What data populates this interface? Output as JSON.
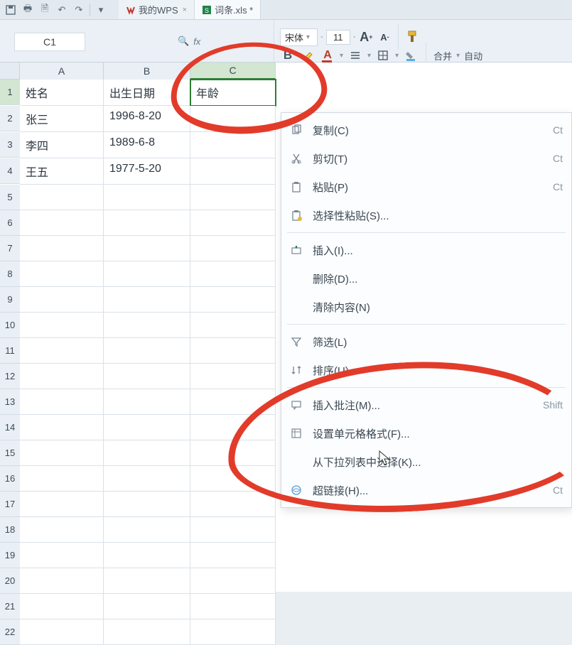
{
  "qat": {
    "save": "💾",
    "undo": "↶",
    "redo": "↷"
  },
  "tabs": [
    {
      "icon_color": "#c0392b",
      "label": "我的WPS",
      "closable": true,
      "active": false
    },
    {
      "icon_color": "#1e8449",
      "label": "词条.xls *",
      "closable": false,
      "active": true
    }
  ],
  "cell_ref": "C1",
  "fx_label": "fx",
  "font": {
    "name": "宋体",
    "size": "11",
    "inc_label": "A",
    "dec_label": "A",
    "bold": "B",
    "underline_a": "A",
    "merge_label": "合并",
    "auto_label": "自动"
  },
  "columns": [
    "A",
    "B",
    "C"
  ],
  "rows": [
    "1",
    "2",
    "3",
    "4",
    "5",
    "6",
    "7",
    "8",
    "9",
    "10",
    "11",
    "12",
    "13",
    "14",
    "15",
    "16",
    "17",
    "18",
    "19",
    "20",
    "21",
    "22"
  ],
  "data": {
    "A1": "姓名",
    "B1": "出生日期",
    "C1": "年龄",
    "A2": "张三",
    "B2": "1996-8-20",
    "A3": "李四",
    "B3": "1989-6-8",
    "A4": "王五",
    "B4": "1977-5-20"
  },
  "selected_cell": "C1",
  "context_menu": {
    "items": [
      {
        "icon": "copy",
        "label": "复制(C)",
        "shortcut": "Ct"
      },
      {
        "icon": "cut",
        "label": "剪切(T)",
        "shortcut": "Ct"
      },
      {
        "icon": "paste",
        "label": "粘贴(P)",
        "shortcut": "Ct"
      },
      {
        "icon": "paste-special",
        "label": "选择性粘贴(S)..."
      },
      {
        "sep": true
      },
      {
        "icon": "insert",
        "label": "插入(I)..."
      },
      {
        "icon": "",
        "label": "删除(D)..."
      },
      {
        "icon": "",
        "label": "清除内容(N)"
      },
      {
        "sep": true
      },
      {
        "icon": "filter",
        "label": "筛选(L)"
      },
      {
        "icon": "sort",
        "label": "排序(U)"
      },
      {
        "sep": true
      },
      {
        "icon": "comment",
        "label": "插入批注(M)...",
        "shortcut": "Shift"
      },
      {
        "icon": "format",
        "label": "设置单元格格式(F)..."
      },
      {
        "icon": "",
        "label": "从下拉列表中选择(K)..."
      },
      {
        "icon": "link",
        "label": "超链接(H)...",
        "shortcut": "Ct"
      }
    ]
  }
}
